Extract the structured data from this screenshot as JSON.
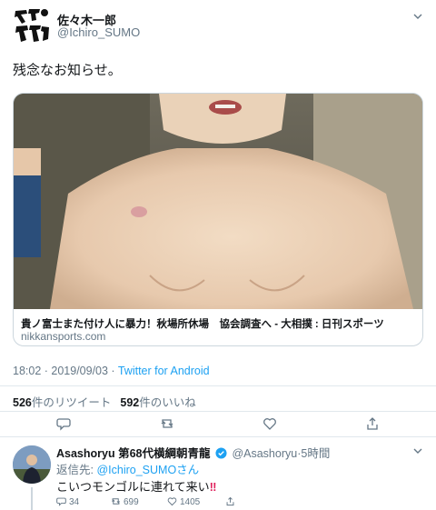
{
  "tweet": {
    "author_name": "佐々木一郎",
    "author_handle": "@Ichiro_SUMO",
    "avatar_text": "デスク",
    "text": "残念なお知らせ。",
    "card": {
      "title": "貴ノ富士また付け人に暴力！秋場所休場　協会調査へ - 大相撲 : 日刊スポーツ",
      "domain": "nikkansports.com"
    },
    "time_date": "18:02 · 2019/09/03 · ",
    "source": "Twitter for Android",
    "retweets_count": "526",
    "retweets_label": "件のリツイート",
    "likes_count": "592",
    "likes_label": "件のいいね",
    "actions": [
      "reply-icon",
      "retweet-icon",
      "like-icon",
      "share-icon"
    ]
  },
  "reply": {
    "author_name": "Asashoryu 第68代横綱朝青龍",
    "author_handle": "@Asashoryu",
    "time": "·5時間",
    "reply_to_prefix": "返信先: ",
    "reply_to_handle": "@Ichiro_SUMOさん",
    "text": "こいつモンゴルに連れて来い",
    "emphasis": "‼",
    "reply_count": "34",
    "retweet_count": "699",
    "like_count": "1405"
  },
  "colors": {
    "link": "#1da1f2",
    "secondary_text": "#657786",
    "border": "#e1e8ed",
    "alert": "#e0245e"
  }
}
